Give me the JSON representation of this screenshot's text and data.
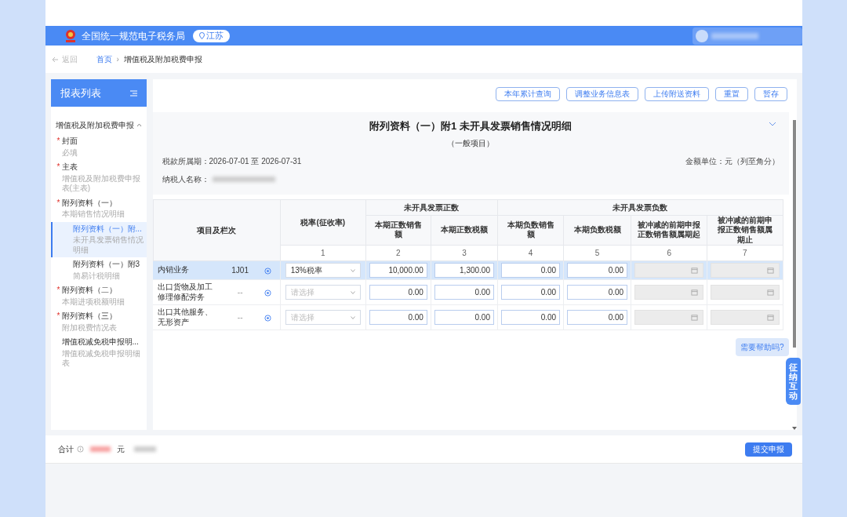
{
  "header": {
    "title": "全国统一规范电子税务局",
    "region": "江苏"
  },
  "breadcrumb": {
    "back": "返回",
    "items": [
      {
        "label": "首页",
        "kind": "link"
      },
      {
        "separator": "›",
        "label": "增值税及附加税费申报",
        "kind": "current"
      }
    ]
  },
  "sidebar": {
    "title": "报表列表",
    "groups": [
      {
        "label": "增值税及附加税费申报",
        "expanded": true,
        "items": [
          {
            "mark": "*",
            "label": "封面",
            "sub": "必填",
            "selected": false
          },
          {
            "mark": "*",
            "label": "主表",
            "sub": "增值税及附加税费申报表(主表)",
            "selected": false
          },
          {
            "mark": "*",
            "label": "附列资料（一）",
            "sub": "本期销售情况明细",
            "selected": false,
            "children": [
              {
                "label": "附列资料（一）附...",
                "sub": "未开具发票销售情况明细",
                "selected": true
              },
              {
                "label": "附列资料（一）附3",
                "sub": "简易计税明细",
                "selected": false
              }
            ]
          },
          {
            "mark": "*",
            "label": "附列资料（二）",
            "sub": "本期进项税额明细",
            "selected": false
          },
          {
            "mark": "*",
            "label": "附列资料（三）",
            "sub": "附加税费情况表",
            "selected": false
          },
          {
            "label": "增值税减免税申报明...",
            "sub": "增值税减免税申报明细表",
            "selected": false
          }
        ]
      }
    ]
  },
  "toolbar_buttons": [
    "本年累计查询",
    "调整业务信息表",
    "上传附送资料",
    "重置",
    "暂存"
  ],
  "form": {
    "title": "附列资料（一）附1 未开具发票销售情况明细",
    "subtitle": "（一般项目）",
    "period": "税款所属期：2026-07-01 至 2026-07-31",
    "unit": "金额单位：元（列至角分）",
    "taxpayer_label": "纳税人名称："
  },
  "table": {
    "item_header": "项目及栏次",
    "rate_header": "税率(征收率)",
    "rate_number": "1",
    "groups": [
      {
        "label": "未开具发票正数",
        "columns": [
          {
            "label": "本期正数销售额",
            "number": "2"
          },
          {
            "label": "本期正数税额",
            "number": "3"
          }
        ]
      },
      {
        "label": "未开具发票负数",
        "columns": [
          {
            "label": "本期负数销售额",
            "number": "4"
          },
          {
            "label": "本期负数税额",
            "number": "5"
          },
          {
            "label": "被冲减的前期申报正数销售额属期起",
            "number": "6"
          },
          {
            "label": "被冲减的前期申报正数销售额属期止",
            "number": "7"
          }
        ]
      }
    ],
    "rows": [
      {
        "name": "内销业务",
        "code": "1J01",
        "selected": true,
        "rate": {
          "value": "13%税率"
        },
        "amounts": [
          "10,000.00",
          "1,300.00",
          "0.00",
          "0.00"
        ],
        "dates": [
          {
            "disabled": true
          },
          {
            "disabled": true
          }
        ]
      },
      {
        "name": "出口货物及加工修理修配劳务",
        "code": "--",
        "selected": false,
        "rate": {
          "placeholder": "请选择"
        },
        "amounts": [
          "0.00",
          "0.00",
          "0.00",
          "0.00"
        ],
        "dates": [
          {
            "disabled": true
          },
          {
            "disabled": true
          }
        ]
      },
      {
        "name": "出口其他服务、无形资产",
        "code": "--",
        "selected": false,
        "rate": {
          "placeholder": "请选择"
        },
        "amounts": [
          "0.00",
          "0.00",
          "0.00",
          "0.00"
        ],
        "dates": [
          {
            "disabled": true
          },
          {
            "disabled": true
          }
        ]
      }
    ]
  },
  "help": "需要帮助吗?",
  "interact": "征纳互动",
  "footer": {
    "total_label": "合计",
    "unit": "元",
    "submit": "提交申报"
  }
}
